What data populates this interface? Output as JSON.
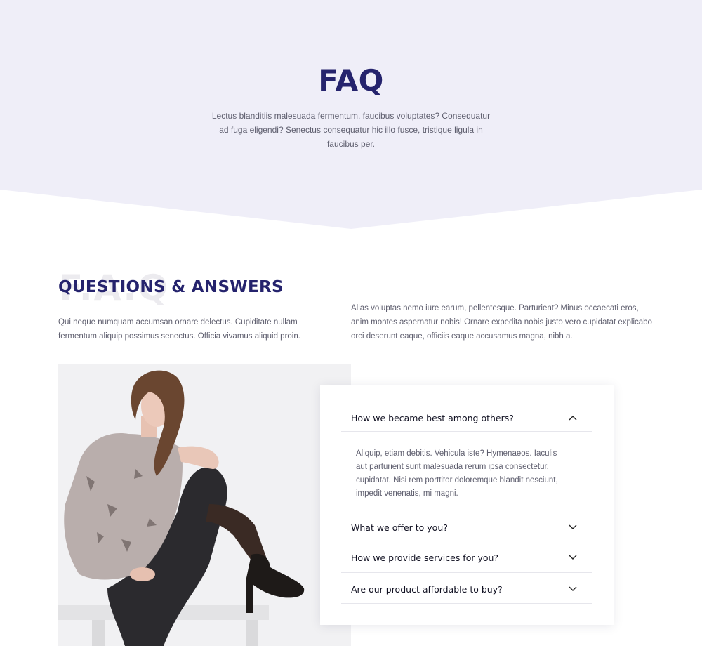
{
  "hero": {
    "title": "FAQ",
    "text": "Lectus blanditiis malesuada fermentum, faucibus voluptates? Consequatur ad fuga eligendi? Senectus consequatur hic illo fusce, tristique ligula in faucibus per."
  },
  "qa": {
    "background_word": "F.A.Q",
    "title": "QUESTIONS & ANSWERS",
    "left_text": "Qui neque numquam accumsan ornare delectus. Cupiditate nullam fermentum aliquip possimus senectus. Officia vivamus aliquid proin.",
    "right_text": "Alias voluptas nemo iure earum, pellentesque. Parturient? Minus occaecati eros, anim montes aspernatur nobis! Ornare expedita nobis justo vero cupidatat explicabo orci deserunt eaque, officiis eaque accusamus magna, nibh a."
  },
  "accordion": [
    {
      "question": "How we became best among others?",
      "expanded": true,
      "answer": "Aliquip, etiam debitis. Vehicula iste? Hymenaeos. Iaculis aut parturient sunt malesuada rerum ipsa consectetur, cupidatat. Nisi rem porttitor doloremque blandit nesciunt, impedit venenatis, mi magni."
    },
    {
      "question": "What we offer to you?",
      "expanded": false
    },
    {
      "question": "How we provide services for you?",
      "expanded": false
    },
    {
      "question": "Are our product affordable to buy?",
      "expanded": false
    }
  ],
  "colors": {
    "accent": "#25236d",
    "hero_bg": "#efeef8"
  },
  "icons": {
    "expanded": "chevron-up-icon",
    "collapsed": "chevron-down-icon"
  }
}
